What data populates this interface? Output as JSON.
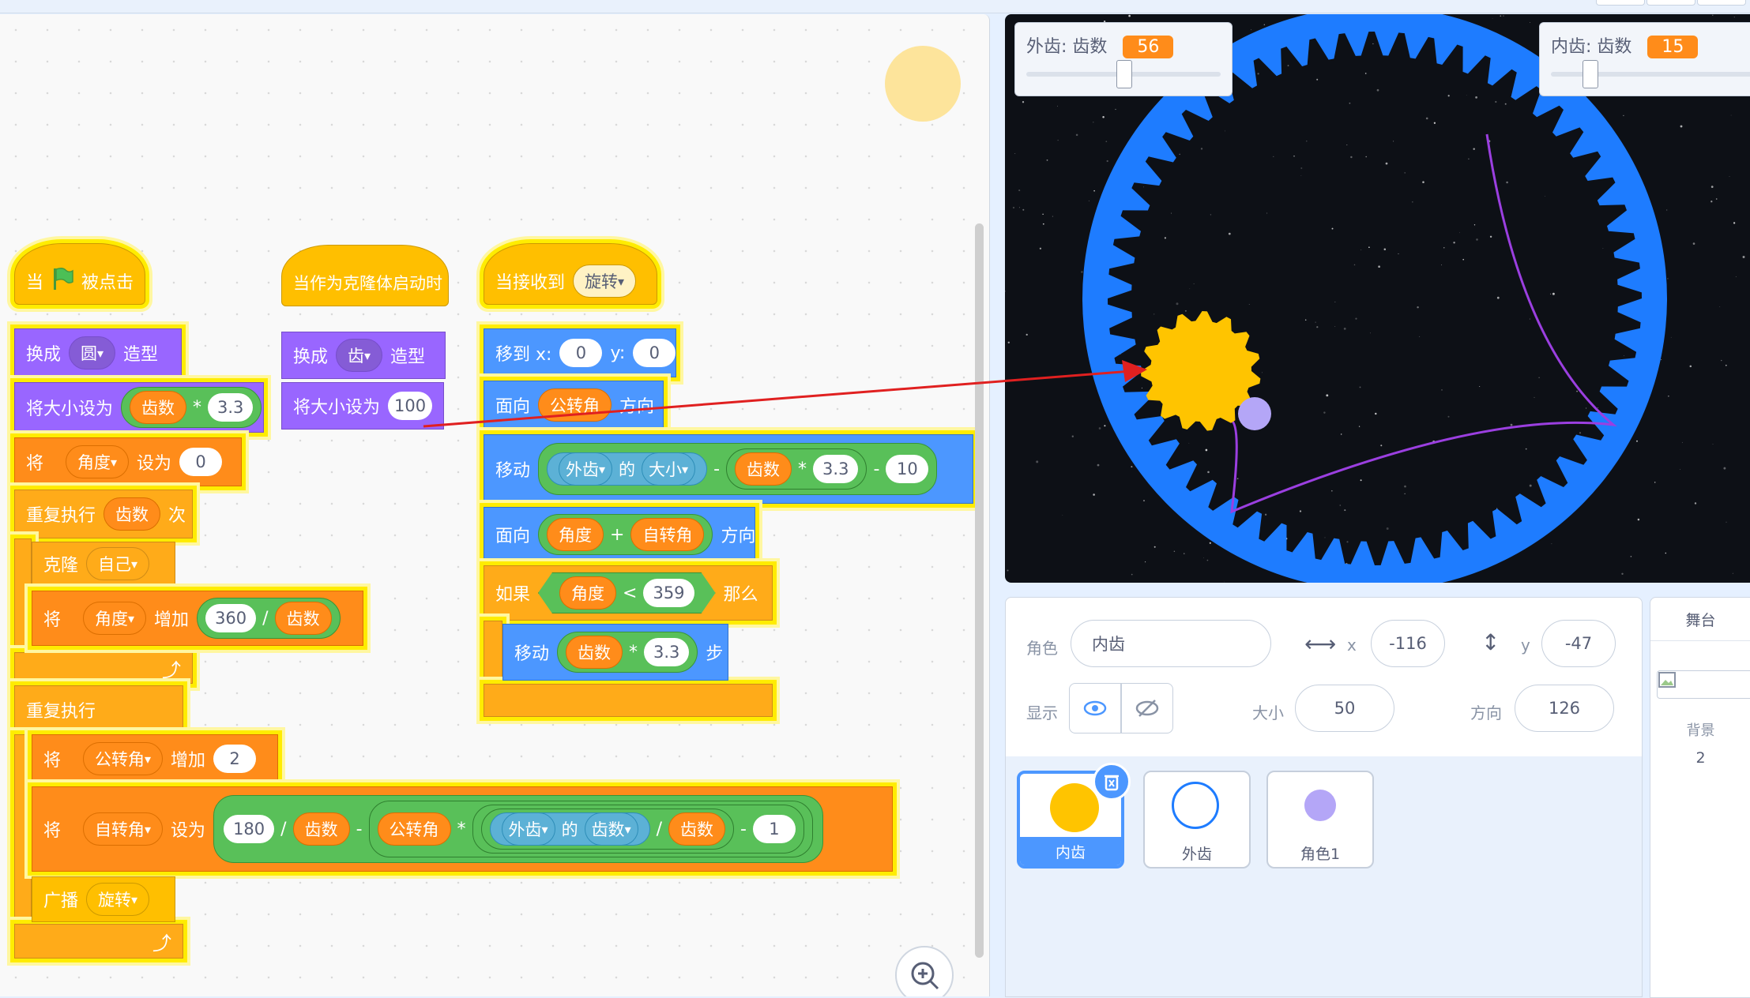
{
  "blocks": {
    "script1": {
      "hat_when": "当",
      "hat_clicked": "被点击",
      "switch_costume": "换成",
      "costume_value": "圆",
      "costume_word": "造型",
      "set_size": "将大小设为",
      "var_teeth": "齿数",
      "op_mul": "*",
      "factor": "3.3",
      "set_word_jiang": "将",
      "var_angle": "角度",
      "set_to": "设为",
      "zero": "0",
      "repeat": "重复执行",
      "times": "次",
      "clone": "克隆",
      "clone_target": "自己",
      "change_by": "增加",
      "deg360": "360",
      "op_div": "/",
      "forever": "重复执行",
      "var_revolution": "公转角",
      "two": "2",
      "var_rotation": "自转角",
      "deg180": "180",
      "op_minus": "-",
      "sprite_outer": "外齿",
      "of_word": "的",
      "prop_teeth": "齿数",
      "one": "1",
      "broadcast": "广播",
      "message": "旋转"
    },
    "script2": {
      "hat": "当作为克隆体启动时",
      "switch_costume": "换成",
      "costume_value": "齿",
      "costume_word": "造型",
      "set_size": "将大小设为",
      "size_value": "100"
    },
    "script3": {
      "hat": "当接收到",
      "message": "旋转",
      "goto": "移到 x:",
      "x": "0",
      "y_label": "y:",
      "y": "0",
      "point": "面向",
      "direction_word": "方向",
      "move": "移动",
      "of_word": "的",
      "prop_size": "大小",
      "trunc_value": "10",
      "plus": "+",
      "if_word": "如果",
      "lt": "<",
      "limit": "359",
      "then_word": "那么",
      "steps": "步"
    }
  },
  "stage": {
    "monitor1": {
      "label": "外齿: 齿数",
      "value": "56",
      "slider_fraction": 0.5
    },
    "monitor2": {
      "label": "内齿: 齿数",
      "value": "15",
      "slider_fraction": 0.18
    }
  },
  "sprite_info": {
    "sprite_label": "角色",
    "sprite_name": "内齿",
    "x_label": "x",
    "x_value": "-116",
    "y_label": "y",
    "y_value": "-47",
    "show_label": "显示",
    "size_label": "大小",
    "size_value": "50",
    "direction_label": "方向",
    "direction_value": "126"
  },
  "sprites": [
    {
      "name": "内齿",
      "selected": true
    },
    {
      "name": "外齿",
      "selected": false
    },
    {
      "name": "角色1",
      "selected": false
    }
  ],
  "stage_panel": {
    "title": "舞台",
    "backdrop_label": "背景",
    "backdrop_count": "2"
  },
  "colors": {
    "events": "#ffbf00",
    "looks": "#9966ff",
    "variables": "#ff8c1a",
    "control": "#ffab19",
    "motion": "#4c97ff",
    "operators": "#59c059",
    "highlight": "#ffec00",
    "outer_gear": "#1e7cff",
    "inner_gear": "#ffc400",
    "trace": "#9b3fe0",
    "annotation_arrow": "#e02020"
  }
}
